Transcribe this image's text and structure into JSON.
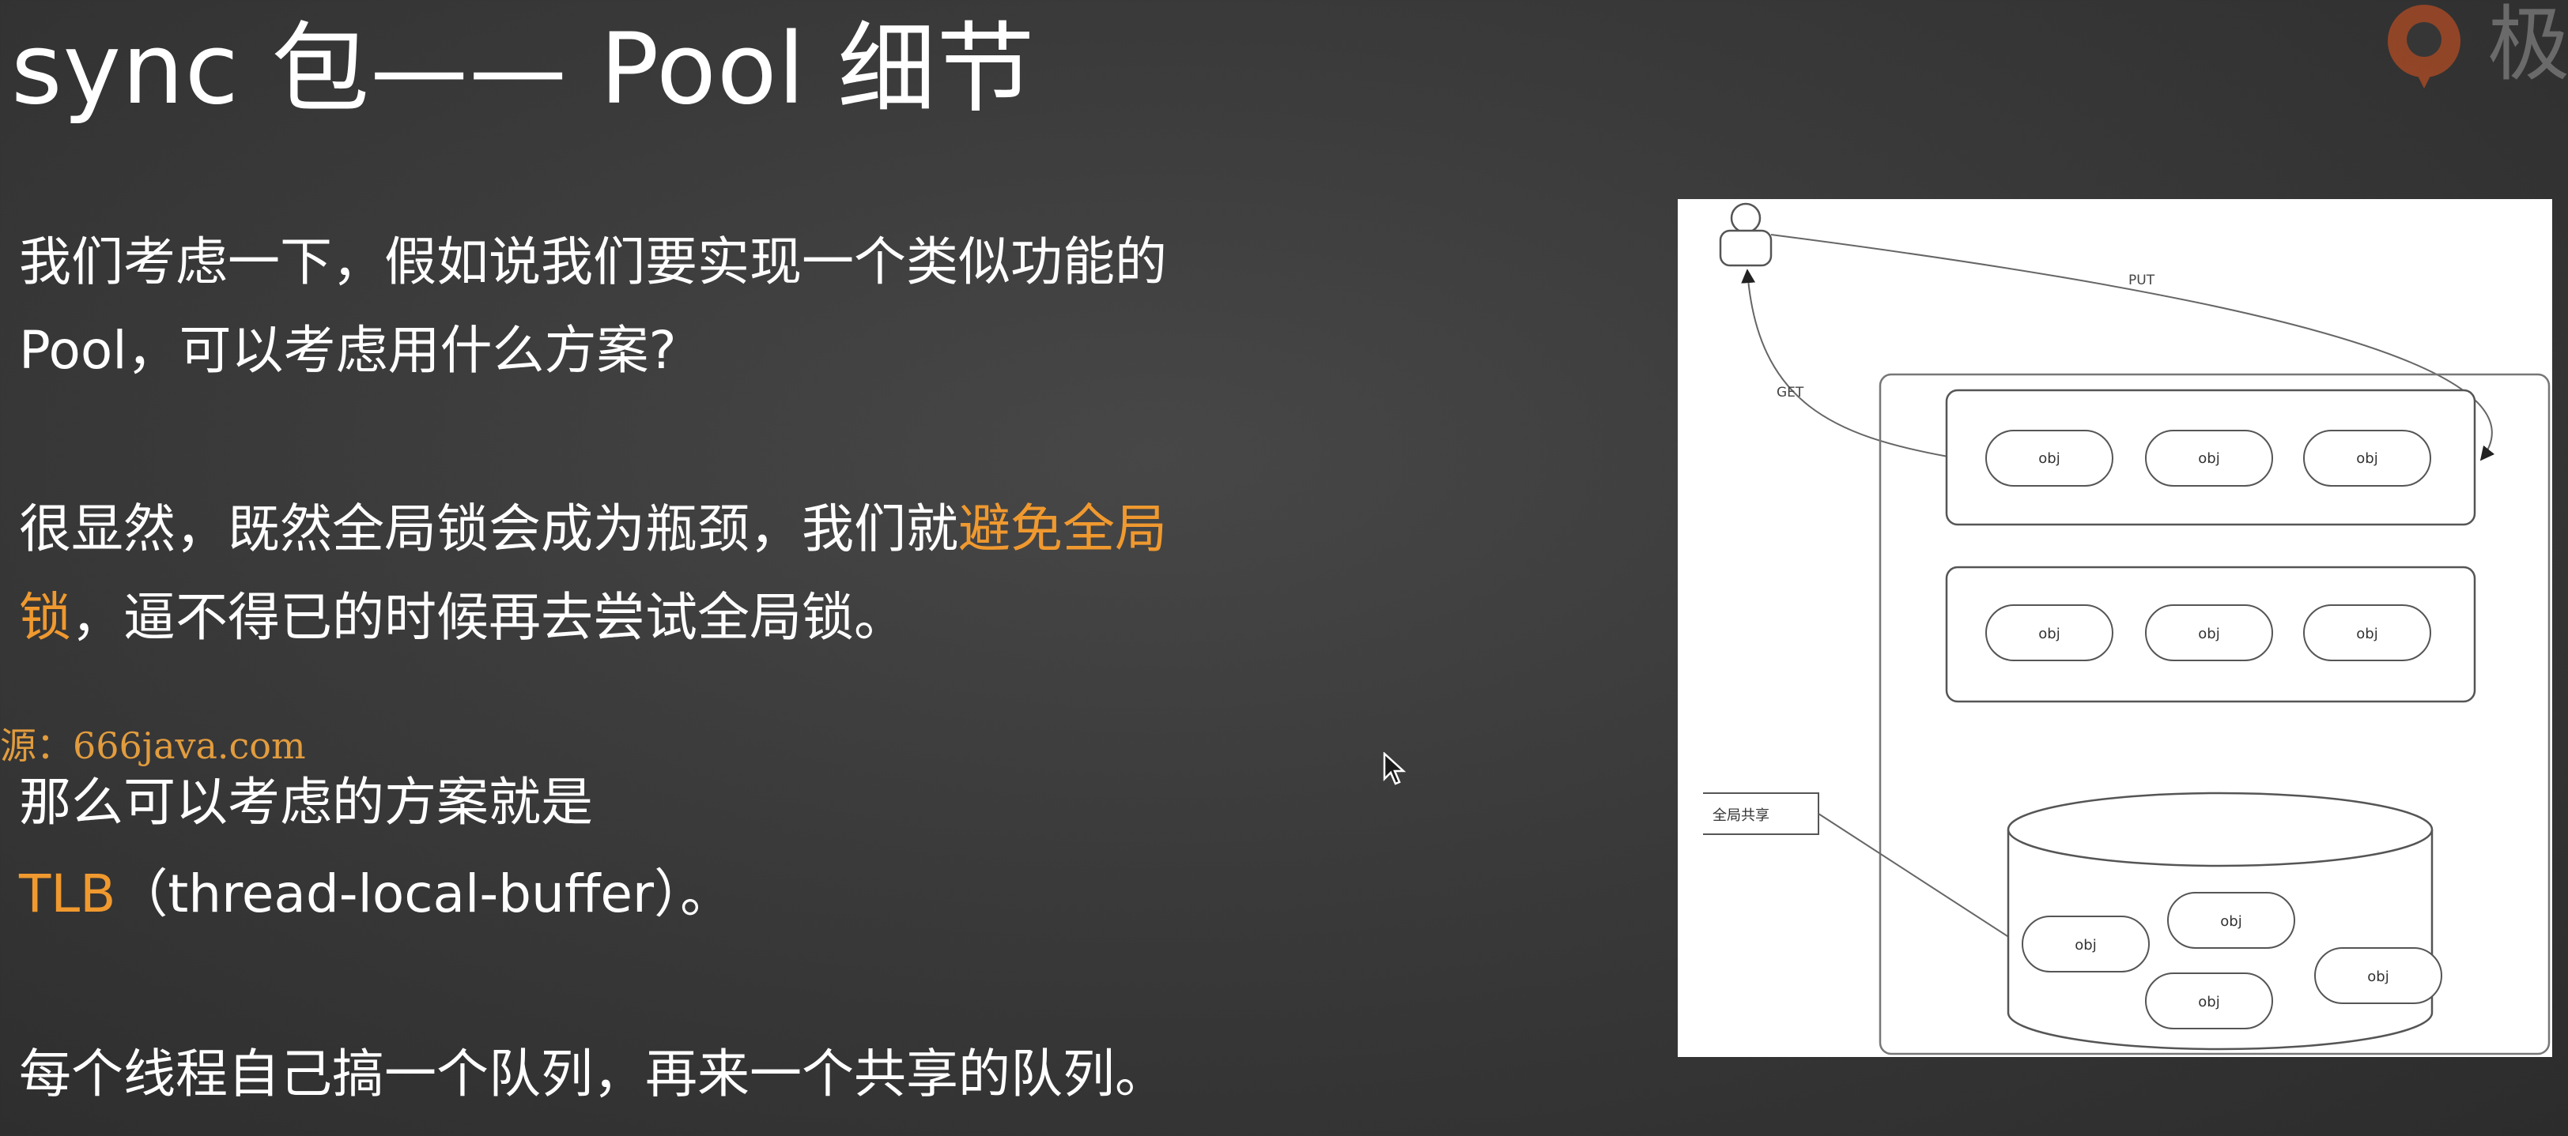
{
  "slide": {
    "title": "sync 包—— Pool 细节",
    "paragraphs": {
      "p1_line1": "我们考虑一下，假如说我们要实现一个类似功能的",
      "p1_line2": "Pool，可以考虑用什么方案?",
      "p2_line1_plain": "很显然，既然全局锁会成为瓶颈，我们就",
      "p2_line1_highlight": "避免全局",
      "p2_line2_highlight": "锁",
      "p2_line2_plain": "，逼不得已的时候再去尝试全局锁。",
      "p3_line1": "那么可以考虑的方案就是",
      "p3_line2_highlight": "TLB",
      "p3_line2_plain": "（thread-local-buffer）。",
      "p4_line1": "每个线程自己搞一个队列，再来一个共享的队列。"
    },
    "watermark": "源：666java.com",
    "logo": {
      "text": "极",
      "icon": "brand-logo-icon"
    },
    "highlight_color": "#f0992f"
  },
  "diagram": {
    "labels": {
      "put": "PUT",
      "get": "GET",
      "shared": "全局共享"
    },
    "obj_label": "obj"
  }
}
